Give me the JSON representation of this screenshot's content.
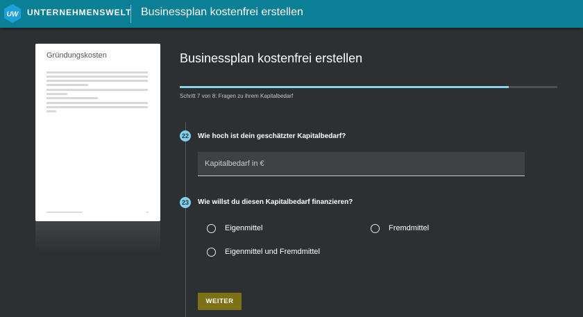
{
  "header": {
    "logo_text": "UW",
    "brand": "UNTERNEHMENSWELT",
    "title": "Businessplan kostenfrei erstellen"
  },
  "preview": {
    "title": "Gründungskosten"
  },
  "form": {
    "title": "Businessplan kostenfrei erstellen",
    "progress": {
      "current_step": 7,
      "total_steps": 8,
      "fraction": 0.872
    },
    "step_text": "Schritt 7 von 8: Fragen zu ihrem Kapitalbedarf",
    "questions": [
      {
        "number": "22",
        "text": "Wie hoch ist dein geschätzter Kapitalbedarf?",
        "input_placeholder": "Kapitalbedarf in €",
        "input_value": ""
      },
      {
        "number": "23",
        "text": "Wie willst du diesen Kapitalbedarf finanzieren?",
        "options": [
          "Eigenmittel",
          "Fremdmittel",
          "Eigenmittel und Fremdmittel"
        ],
        "selected": null
      }
    ],
    "next_button": "WEITER"
  },
  "colors": {
    "header_bg": "#0a7f96",
    "page_bg": "#2d3032",
    "accent_badge": "#7fd0eb",
    "progress": "#8ad4ea",
    "button_bg": "#7d7118"
  }
}
